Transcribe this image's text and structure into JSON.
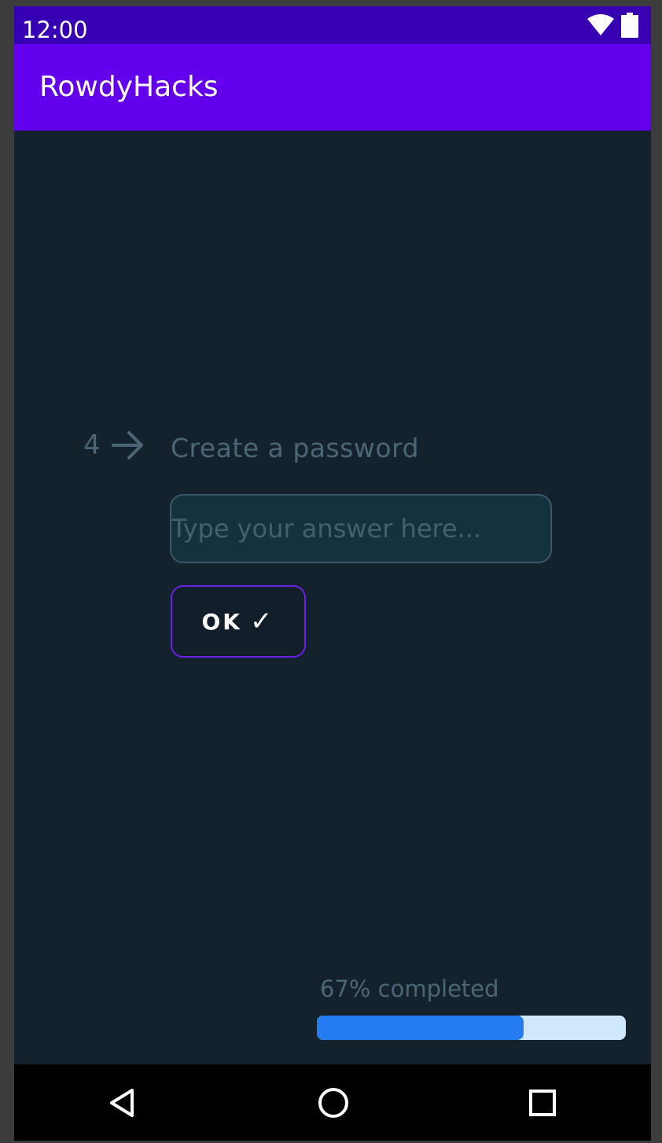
{
  "status_bar": {
    "time": "12:00",
    "icons": [
      "wifi-icon",
      "battery-icon"
    ]
  },
  "app_bar": {
    "title": "RowdyHacks"
  },
  "question": {
    "number": "4",
    "number_icon": "arrow-right-icon",
    "text": "Create a password"
  },
  "answer": {
    "placeholder": "Type your answer here...",
    "value": ""
  },
  "ok_button": {
    "label": "OK",
    "icon": "✓"
  },
  "progress": {
    "label": "67% completed",
    "percent": 67
  },
  "nav_bar": {
    "icons": [
      "back-icon",
      "home-icon",
      "recents-icon"
    ]
  },
  "colors": {
    "status_bar": "#3700b3",
    "app_bar": "#6200ee",
    "background": "#14222d",
    "muted_text": "#4b6777",
    "button_border": "#6a1fe6",
    "progress_fill": "#257cf0",
    "progress_track": "#cfe9fb"
  }
}
